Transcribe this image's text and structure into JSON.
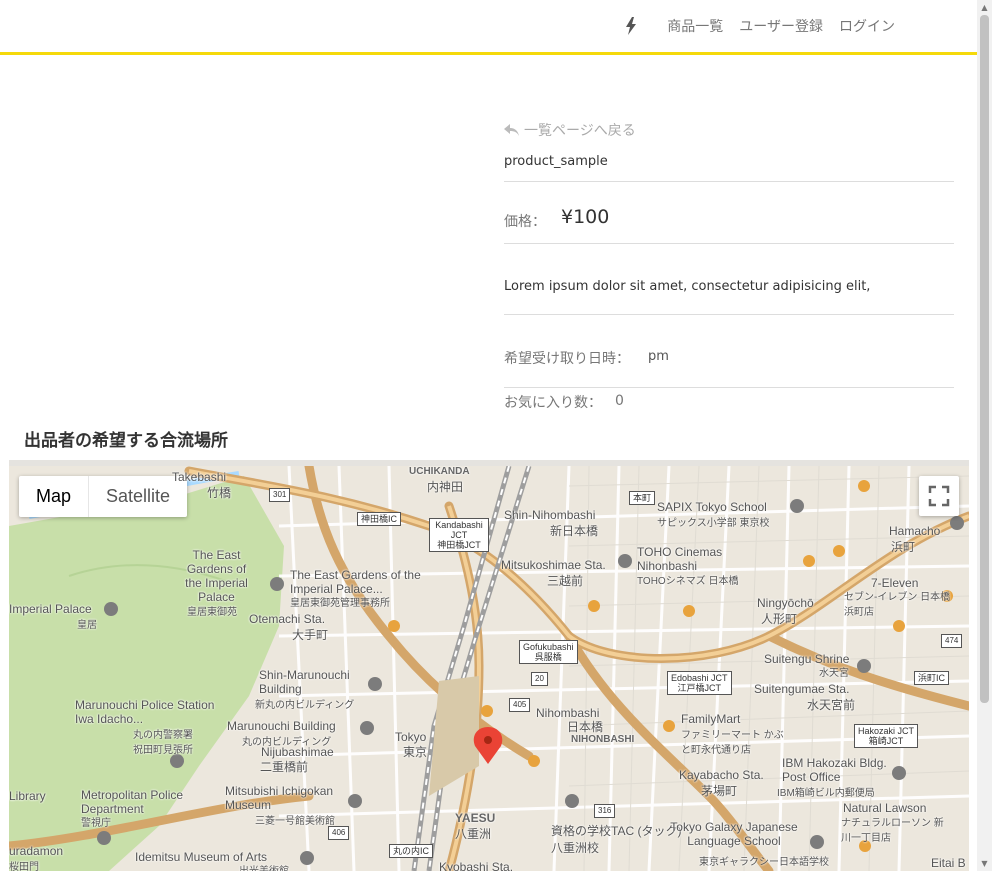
{
  "nav": {
    "items": [
      "商品一覧",
      "ユーザー登録",
      "ログイン"
    ]
  },
  "product": {
    "back_link": "一覧ページへ戻る",
    "name": "product_sample",
    "price_label": "価格：",
    "price_value": "¥100",
    "description": "Lorem ipsum dolor sit amet, consectetur adipisicing elit,",
    "pickup_label": "希望受け取り日時：",
    "pickup_value": "pm",
    "favorites_label": "お気に入り数：",
    "favorites_value": "0"
  },
  "map_section": {
    "title": "出品者の希望する合流場所"
  },
  "map": {
    "type_map": "Map",
    "type_satellite": "Satellite",
    "labels": [
      "Takebashi",
      "竹橋",
      "UCHIKANDA",
      "内神田",
      "神田橋IC",
      "Kandabashi JCT",
      "神田橋JCT",
      "Shin-Nihombashi",
      "新日本橋",
      "本町",
      "SAPIX Tokyo School",
      "サピックス小学部 東京校",
      "Hamacho",
      "浜町",
      "The East Gardens of the Imperial Palace",
      "The East Gardens of the Imperial Palace...",
      "皇居東御苑管理事務所",
      "Mitsukoshimae Sta.",
      "三越前",
      "TOHO Cinemas Nihonbashi",
      "TOHOシネマズ 日本橋",
      "7-Eleven",
      "セブン-イレブン 日本橋浜町店",
      "Imperial Palace",
      "皇居",
      "皇居東御苑",
      "Otemachi Sta.",
      "大手町",
      "Ningyōchō",
      "人形町",
      "Gofukubashi",
      "呉服橋",
      "Shin-Marunouchi Building",
      "新丸の内ビルディング",
      "Suitengu Shrine",
      "水天宮",
      "浜町IC",
      "Edobashi JCT",
      "江戸橋JCT",
      "Suitengumae Sta.",
      "水天宮前",
      "Marunouchi Police Station Iwa Idacho...",
      "丸の内警察署 祝田町見張所",
      "Marunouchi Building",
      "丸の内ビルディング",
      "Tokyo",
      "東京",
      "Nihombashi",
      "日本橋",
      "NIHONBASHI",
      "FamilyMart",
      "ファミリーマート かぶと町永代通り店",
      "Hakozaki JCT",
      "箱崎JCT",
      "Nijubashimae",
      "二重橋前",
      "IBM Hakozaki Bldg. Post Office",
      "IBM箱崎ビル内郵便局",
      "Library",
      "Mitsubishi Ichigokan Museum",
      "三菱一号館美術館",
      "Kayabacho Sta.",
      "茅場町",
      "Metropolitan Police Department",
      "警視庁",
      "Natural Lawson",
      "ナチュラルローソン 新川一丁目店",
      "YAESU",
      "八重洲",
      "資格の学校TAC (タック)八重洲校",
      "Tokyo Galaxy Japanese Language School",
      "東京ギャラクシー日本語学校",
      "uradamon",
      "桜田門",
      "Idemitsu Museum of Arts",
      "出光美術館",
      "丸の内IC",
      "Kyobashi Sta.",
      "Eitai B",
      "301",
      "20",
      "405",
      "316",
      "406",
      "474"
    ]
  },
  "colors": {
    "accent": "#f5d90a",
    "map_bg": "#ece7dd",
    "expressway": "#d4a66a",
    "park": "#c8dfa9",
    "pin": "#ea4335"
  }
}
